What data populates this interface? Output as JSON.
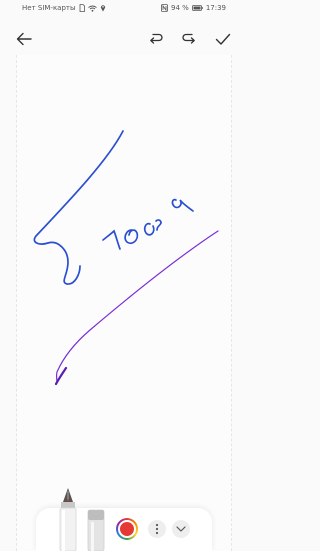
{
  "status": {
    "carrier": "Нет SIM-карты",
    "battery": "94 %",
    "time": "17:39"
  },
  "toolbar": {
    "back_icon": "arrow-left-icon",
    "undo_icon": "undo-icon",
    "redo_icon": "redo-icon",
    "confirm_icon": "check-icon"
  },
  "colors": {
    "stroke_primary": "#2a4fd0",
    "stroke_secondary": "#7a2fd6",
    "current_color": "#e53935"
  },
  "tools": {
    "pen": "fountain-pen-icon",
    "eraser": "eraser-icon",
    "more": "more-vertical-icon",
    "collapse": "chevron-down-icon"
  }
}
